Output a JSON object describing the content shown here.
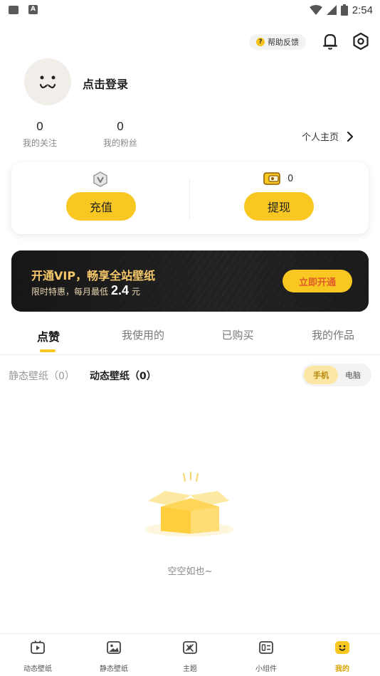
{
  "status_bar": {
    "time": "2:54"
  },
  "header": {
    "help_label": "帮助反馈"
  },
  "profile": {
    "login_label": "点击登录",
    "following_count": "0",
    "following_label": "我的关注",
    "followers_count": "0",
    "followers_label": "我的粉丝",
    "homepage_label": "个人主页"
  },
  "wallet": {
    "recharge_label": "充值",
    "coin_balance": "0",
    "withdraw_label": "提现"
  },
  "vip": {
    "title": "开通VIP，畅享全站壁纸",
    "promo_prefix": "限时特惠，每月最低",
    "price": "2.4",
    "unit": "元",
    "button_label": "立即开通"
  },
  "tabs": [
    {
      "label": "点赞",
      "active": true
    },
    {
      "label": "我使用的",
      "active": false
    },
    {
      "label": "已购买",
      "active": false
    },
    {
      "label": "我的作品",
      "active": false
    }
  ],
  "sub_filters": {
    "static_label": "静态壁纸（0）",
    "dynamic_label": "动态壁纸（0）"
  },
  "device_toggle": {
    "phone": "手机",
    "pc": "电脑",
    "selected": "手机"
  },
  "empty_state": {
    "text": "空空如也~"
  },
  "bottom_nav": [
    {
      "label": "动态壁纸",
      "icon": "video-icon"
    },
    {
      "label": "静态壁纸",
      "icon": "image-icon"
    },
    {
      "label": "主题",
      "icon": "theme-icon"
    },
    {
      "label": "小组件",
      "icon": "widget-icon"
    },
    {
      "label": "我的",
      "icon": "profile-icon",
      "active": true
    }
  ],
  "colors": {
    "accent": "#f8c721",
    "vip_text": "#f6c86a",
    "vip_button_text": "#e05a2a"
  }
}
